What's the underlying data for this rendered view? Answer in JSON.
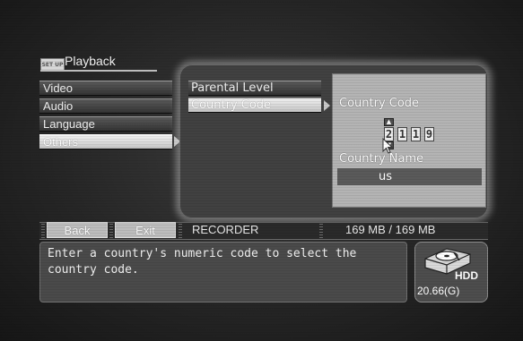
{
  "header": {
    "tag": "SET UP",
    "title": "Playback"
  },
  "left_menu": {
    "items": [
      "Video",
      "Audio",
      "Language",
      "Others"
    ],
    "selected": "Others"
  },
  "sub_menu": {
    "items": [
      "Parental Level",
      "Country Code"
    ],
    "selected": "Country Code"
  },
  "country": {
    "code_label": "Country Code",
    "digits": [
      "2",
      "1",
      "1",
      "9"
    ],
    "up_arrow": "▲",
    "down_arrow": "▼",
    "name_label": "Country Name",
    "name_value": "us"
  },
  "bottom_bar": {
    "back_label": "Back",
    "exit_label": "Exit",
    "mode": "RECORDER",
    "storage": "169 MB  /  169 MB"
  },
  "help_text": "Enter a country's numeric code to select the\ncountry code.",
  "hdd": {
    "label": "HDD",
    "capacity": "20.66(G)",
    "icon": "hard-disk-icon"
  }
}
